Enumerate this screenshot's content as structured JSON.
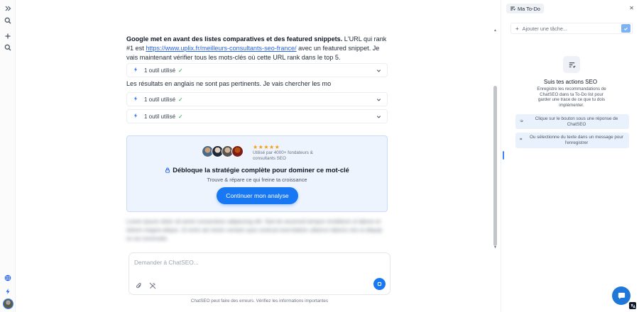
{
  "chat": {
    "msg_bold": "Google met en avant des listes comparatives et des featured snippets.",
    "msg_text1": " L'URL qui rank #1 est ",
    "msg_link": "https://www.uplix.fr/meilleurs-consultants-seo-france/",
    "msg_text2": " avec un featured snippet. Je vais maintenant vérifier tous les mots-clés où cette URL rank dans le top 5.",
    "msg2": "Les résultats en anglais ne sont pas pertinents. Je vais chercher les mo",
    "tool_label": "1 outil utilisé",
    "blurred_text": "Lorem ipsum dolor sit amet consectetur adipiscing elit. Sed do eiusmod tempor incididunt ut labore et dolore magna aliqua. Ut enim ad minim veniam quis nostrud exercitation ullamco laboris nisi ut aliquip ex ea commodo."
  },
  "promo": {
    "stars": "★★★★★",
    "used_by": "Utilisé par 4000+ fondateurs & consultants SEO",
    "title": "Débloque la stratégie complète pour dominer ce mot-clé",
    "subtitle": "Trouve & répare ce qui freine ta croissance",
    "cta": "Continuer mon analyse",
    "accent": "#1877f2"
  },
  "composer": {
    "placeholder": "Demander à ChatSEO...",
    "disclaimer": "ChatSEO peut faire des erreurs. Vérifiez les informations importantes"
  },
  "todo": {
    "tab_label": "Ma To-Do",
    "input_placeholder": "Ajouter une tâche...",
    "empty_title": "Suis tes actions SEO",
    "empty_desc": "Enregistre les recommandations de ChatSEO dans ta To-Do list pour garder une trace de ce que tu dois implémenter.",
    "hint1": "Clique sur le bouton sous une réponse de ChatSEO",
    "hint2": "Ou sélectionne du texte dans un message pour l'enregistrer"
  },
  "icons": {
    "rail": [
      "expand-icon",
      "search-icon",
      "plus-icon",
      "search-icon",
      "globe-icon",
      "bolt-icon"
    ],
    "send": "stop-icon",
    "fab": "chat-bubble-icon"
  }
}
